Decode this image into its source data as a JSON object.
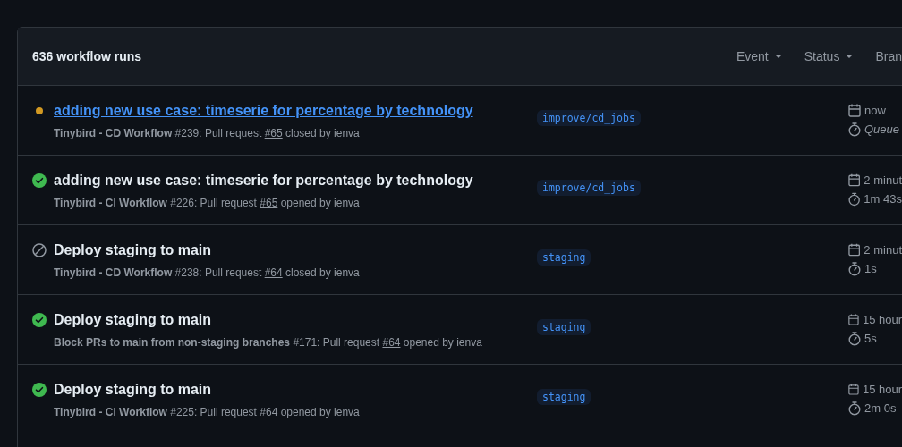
{
  "header": {
    "count": "636 workflow runs",
    "filters": [
      "Event",
      "Status",
      "Bran"
    ]
  },
  "runs": [
    {
      "kind": "queued",
      "title": "adding new use case: timeserie for percentage by technology",
      "highlighted": true,
      "subtitle": "**Tinybird - CD Workflow** #239: Pull request",
      "pr": "#65",
      "action": "closed by ienva",
      "branch": "improve/cd_jobs",
      "date": "now",
      "duration": "Queue"
    },
    {
      "kind": "success",
      "title": "adding new use case: timeserie for percentage by technology",
      "highlighted": false,
      "subtitle": "**Tinybird - CI Workflow** #226: Pull request",
      "pr": "#65",
      "action": "opened by ienva",
      "branch": "improve/cd_jobs",
      "date": "2 minut",
      "duration": "1m 43s"
    },
    {
      "kind": "cancelled",
      "title": "Deploy staging to main",
      "highlighted": false,
      "subtitle": "**Tinybird - CD Workflow** #238: Pull request",
      "pr": "#64",
      "action": "closed by ienva",
      "branch": "staging",
      "date": "2 minut",
      "duration": "1s"
    },
    {
      "kind": "success",
      "title": "Deploy staging to main",
      "highlighted": false,
      "subtitle": "**Block PRs to main from non-staging branches** #171: Pull request",
      "pr": "#64",
      "action": "opened by ienva",
      "branch": "staging",
      "date": "15 hour",
      "duration": "5s"
    },
    {
      "kind": "success",
      "title": "Deploy staging to main",
      "highlighted": false,
      "subtitle": "**Tinybird - CI Workflow** #225: Pull request",
      "pr": "#64",
      "action": "opened by ienva",
      "branch": "staging",
      "date": "15 hour",
      "duration": "2m 0s"
    }
  ]
}
